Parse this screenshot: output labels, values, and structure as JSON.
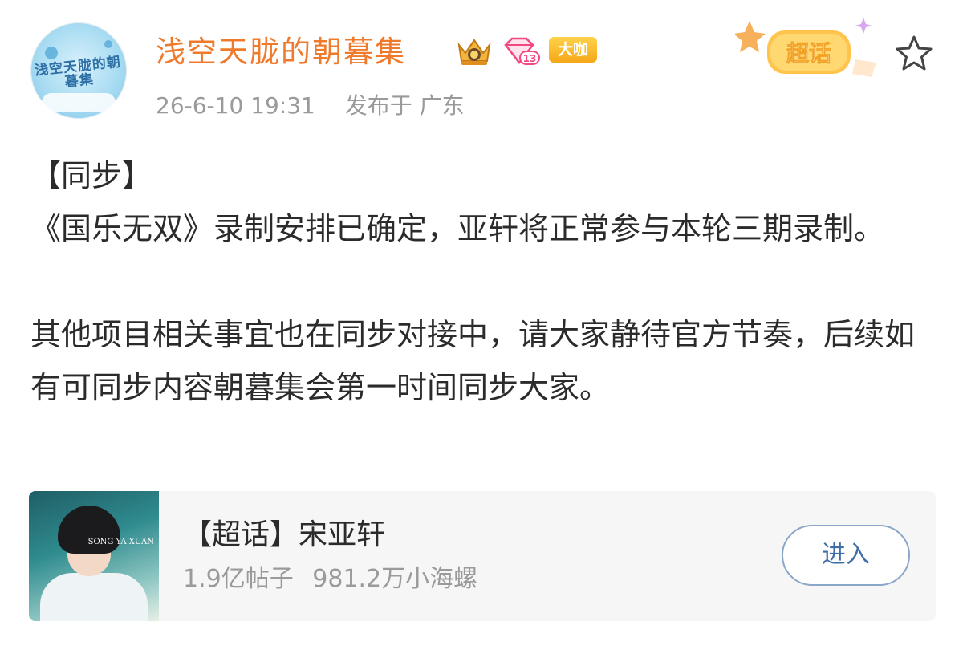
{
  "user": {
    "name": "浅空天胧的朝暮集",
    "avatar_text": "浅空天胧的朝暮集",
    "level": "13",
    "vip_badge": "大咖"
  },
  "post": {
    "time": "26-6-10 19:31",
    "location": "发布于 广东",
    "super_topic_badge": "超话",
    "paragraphs": [
      "【同步】",
      "《国乐无双》录制安排已确定，亚轩将正常参与本轮三期录制。",
      "",
      "其他项目相关事宜也在同步对接中，请大家静待官方节奏，后续如有可同步内容朝暮集会第一时间同步大家。"
    ]
  },
  "card": {
    "title": "【超话】宋亚轩",
    "posts": "1.9亿帖子",
    "followers": "981.2万小海螺",
    "button": "进入",
    "thumb_text": "SONG YA XUAN"
  },
  "colors": {
    "username": "#f07a2c",
    "meta": "#9a9a9a",
    "button_border": "#8aa6c8",
    "button_text": "#3e6ea8",
    "card_bg": "#f6f6f6"
  },
  "icons": {
    "favorite": "star-outline-icon",
    "crown": "crown-icon",
    "level": "diamond-level-icon"
  }
}
